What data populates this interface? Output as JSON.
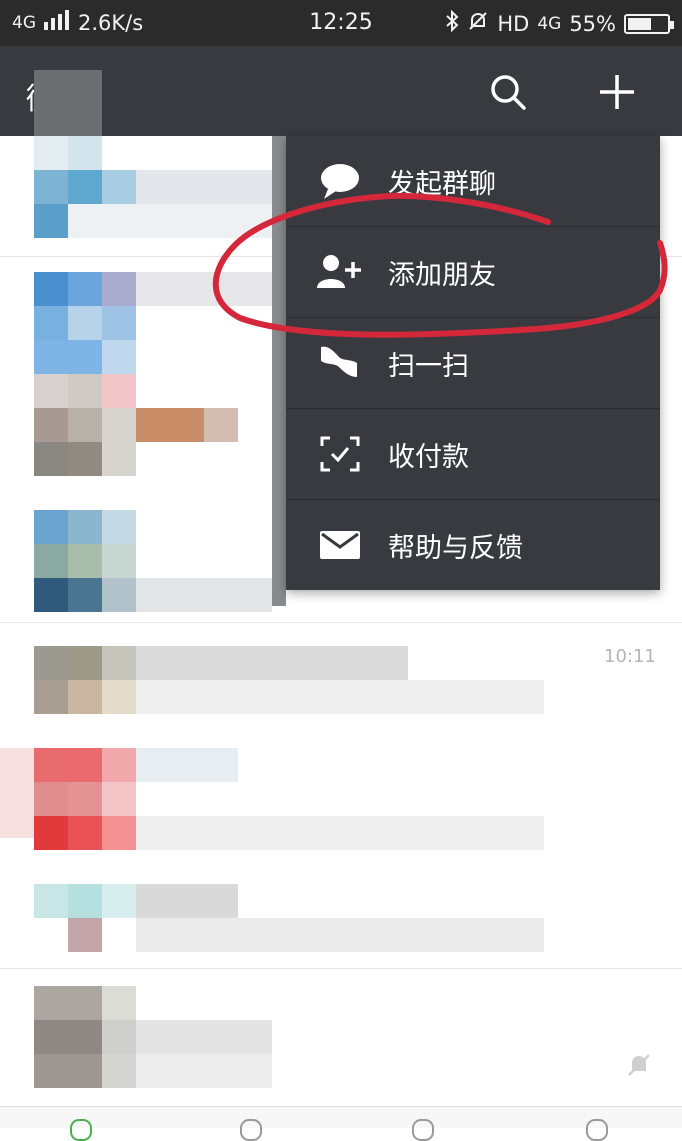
{
  "status_bar": {
    "network": "4G",
    "speed": "2.6K/s",
    "time": "12:25",
    "hd": "HD",
    "network_right": "4G",
    "battery": "55%",
    "battery_level": 0.55
  },
  "app_bar": {
    "title": "微",
    "search_icon": "search-icon",
    "add_icon": "plus-icon"
  },
  "menu": {
    "items": [
      {
        "label": "发起群聊",
        "icon": "chat-bubble-icon"
      },
      {
        "label": "添加朋友",
        "icon": "add-friend-icon"
      },
      {
        "label": "扫一扫",
        "icon": "scan-icon"
      },
      {
        "label": "收付款",
        "icon": "payment-scan-icon"
      },
      {
        "label": "帮助与反馈",
        "icon": "envelope-icon"
      }
    ]
  },
  "chat_list": {
    "visible_time": "10:11",
    "muted_icon": "mute-bell-icon"
  },
  "colors": {
    "status_bar_bg": "#2b2b2b",
    "app_bar_bg": "#393a3f",
    "menu_bg": "#393a3f",
    "annotation_red": "#d4283a"
  }
}
